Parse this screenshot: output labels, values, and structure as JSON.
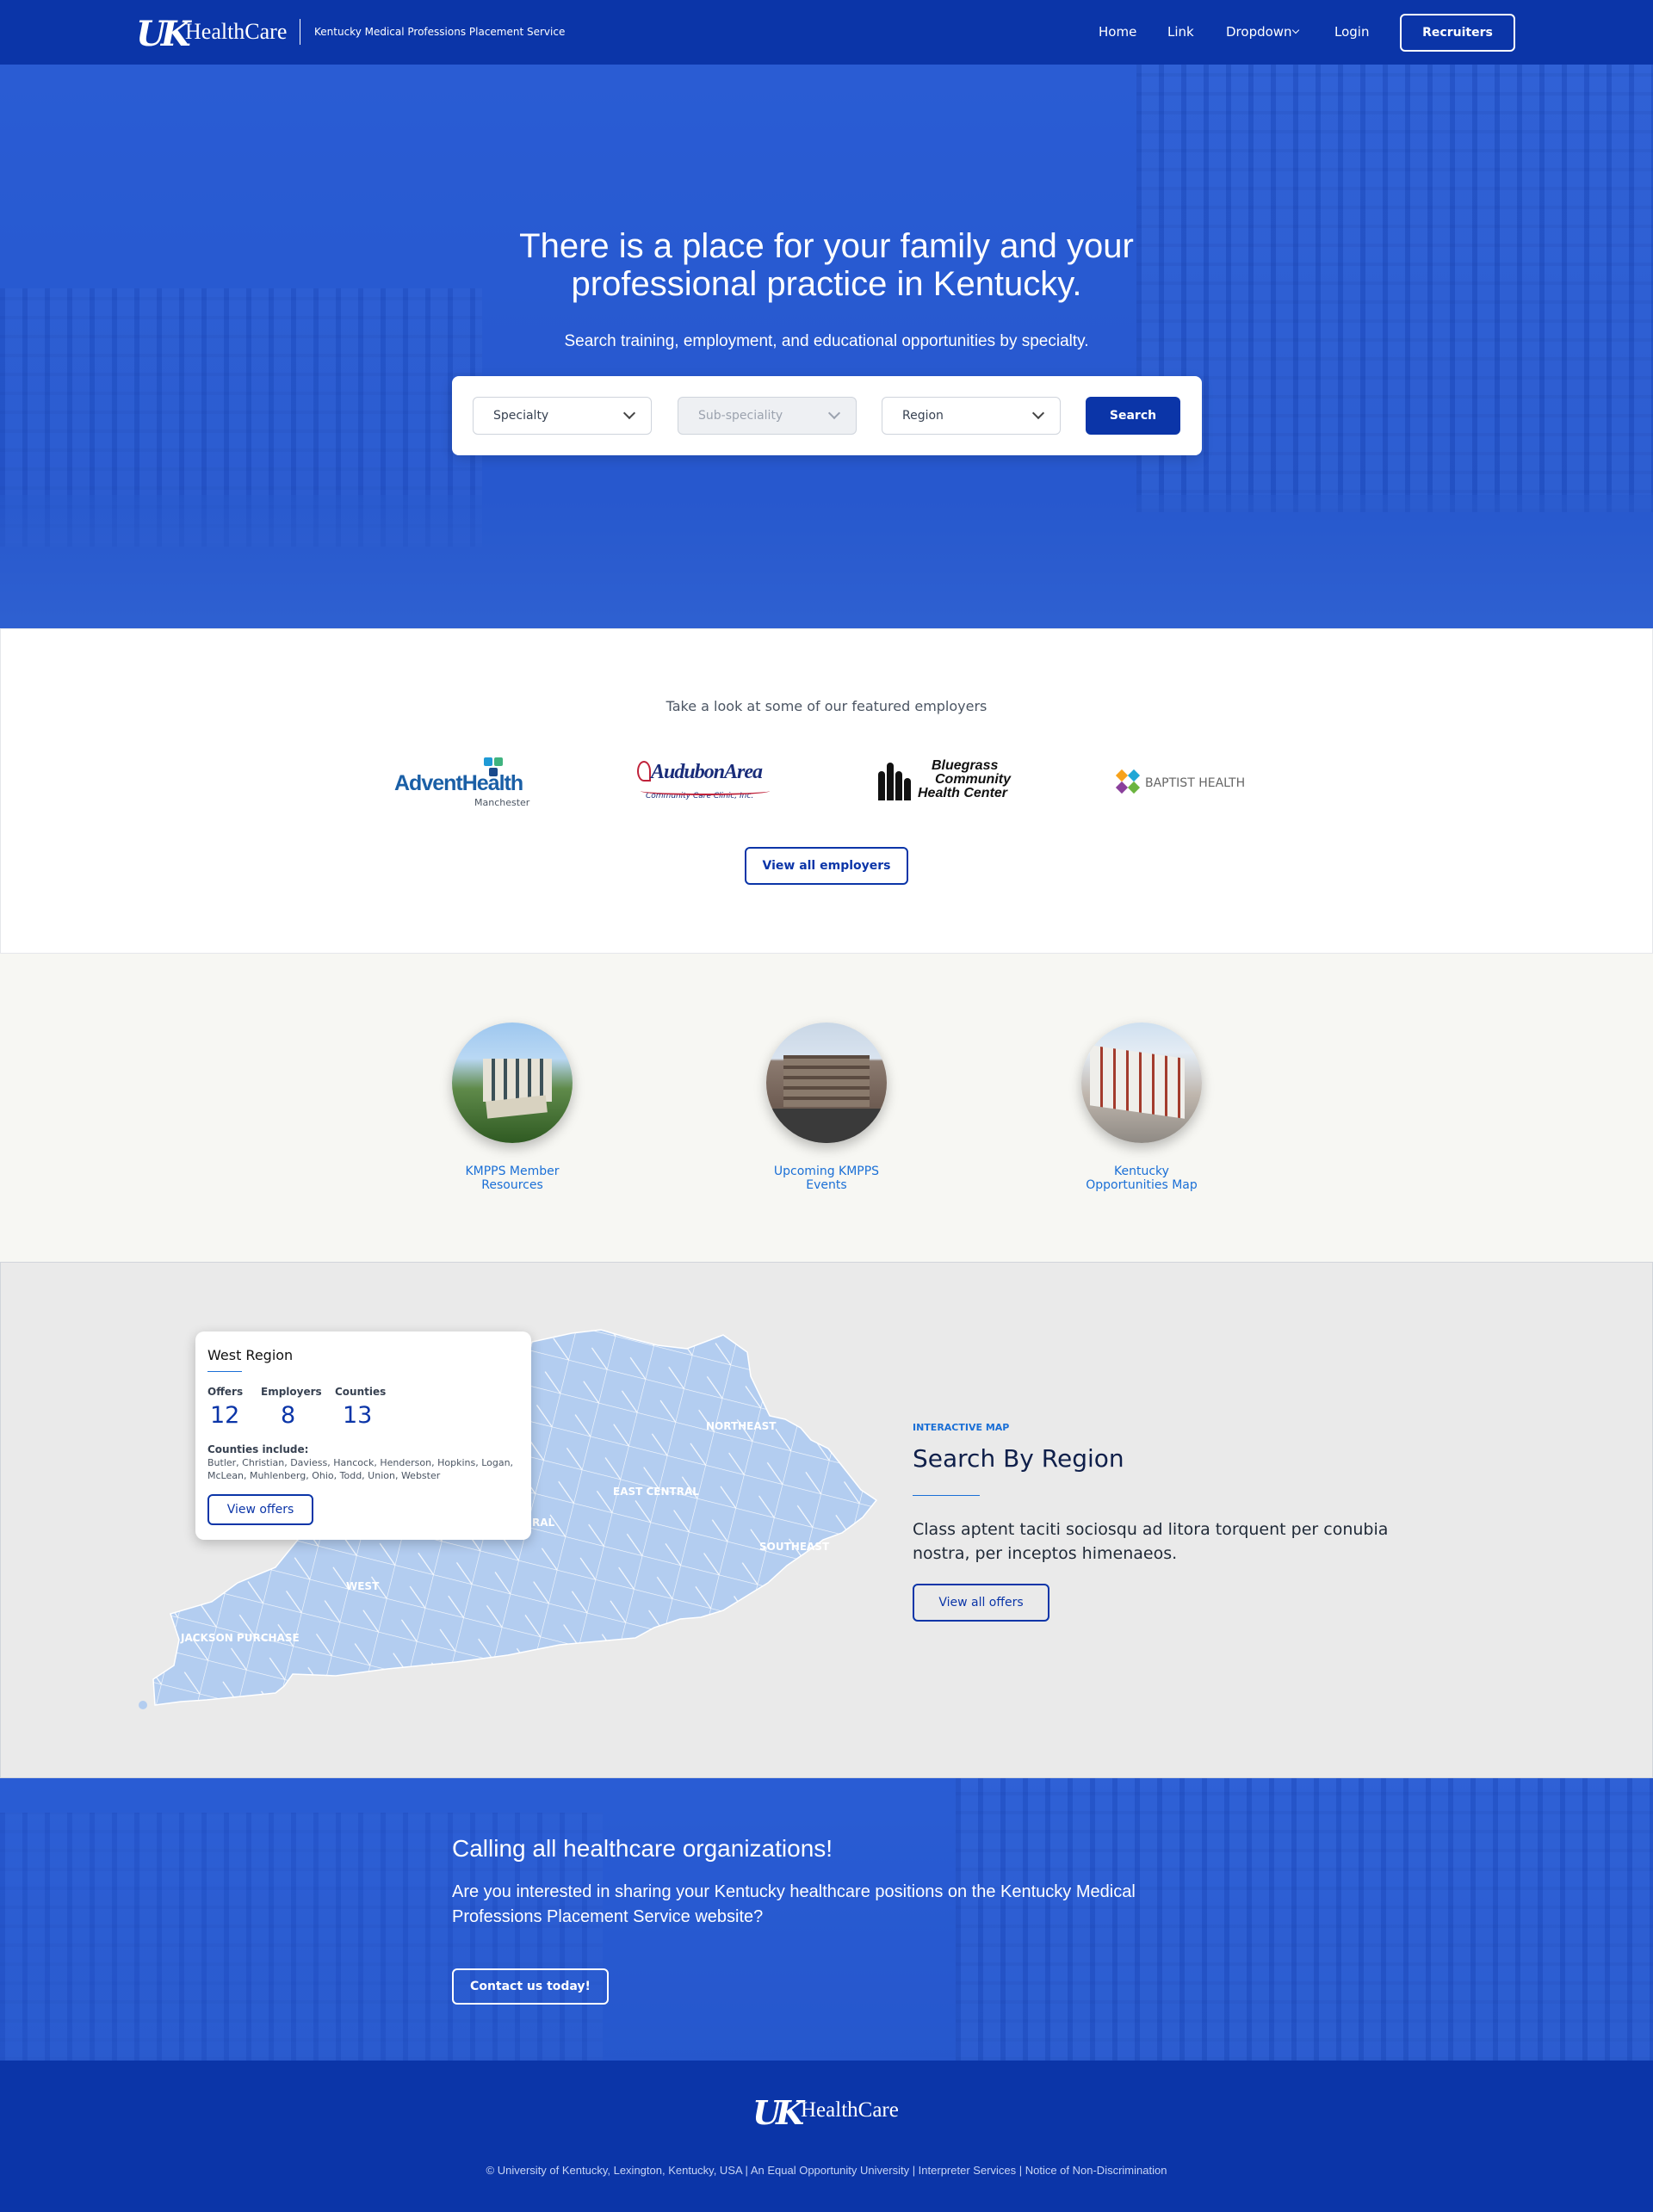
{
  "header": {
    "logo_mark": "UK",
    "logo_text": "HealthCare",
    "tagline": "Kentucky Medical Professions Placement Service",
    "nav": [
      "Home",
      "Link",
      "Dropdown",
      "Login"
    ],
    "cta": "Recruiters"
  },
  "hero": {
    "title_line1": "There is a place for your family and your",
    "title_line2": "professional practice in Kentucky.",
    "subtitle": "Search training, employment, and educational opportunities by specialty.",
    "specialty": "Specialty",
    "subspecialty": "Sub-speciality",
    "region": "Region",
    "search": "Search"
  },
  "employers": {
    "title": "Take a look at some of our featured employers",
    "logos": {
      "advent_main": "AdventHealth",
      "advent_sub": "Manchester",
      "audubon_main": "AudubonArea",
      "audubon_sub": "Community Care Clinic, Inc.",
      "bluegrass_1": "Bluegrass",
      "bluegrass_2": "Community",
      "bluegrass_3": "Health Center",
      "baptist": "BAPTIST HEALTH"
    },
    "view_all": "View all employers"
  },
  "resources": [
    {
      "line1": "KMPPS Member",
      "line2": "Resources"
    },
    {
      "line1": "Upcoming KMPPS",
      "line2": "Events"
    },
    {
      "line1": "Kentucky",
      "line2": "Opportunities Map"
    }
  ],
  "map": {
    "card": {
      "title": "West Region",
      "offers_label": "Offers",
      "offers": "12",
      "employers_label": "Employers",
      "employers": "8",
      "counties_label": "Counties",
      "counties": "13",
      "counties_include_label": "Counties include:",
      "counties_list_1": "Butler, Christian, Daviess, Hancock, Henderson, Hopkins, Logan,",
      "counties_list_2": "McLean, Muhlenberg, Ohio, Todd, Union, Webster",
      "button": "View offers"
    },
    "regions": {
      "northeast": "NORTHEAST",
      "east_central": "EAST CENTRAL",
      "southeast": "SOUTHEAST",
      "west": "WEST",
      "jackson": "JACKSON PURCHASE",
      "central_partial": "RAL"
    },
    "kicker": "INTERACTIVE MAP",
    "heading": "Search By Region",
    "body_1": "Class aptent taciti sociosqu ad litora torquent per conubia",
    "body_2": "nostra, per inceptos himenaeos.",
    "button": "View all offers"
  },
  "cta": {
    "heading": "Calling all healthcare organizations!",
    "body_1": "Are you interested in sharing your Kentucky healthcare positions on the Kentucky Medical",
    "body_2": "Professions Placement Service website?",
    "button": "Contact us today!"
  },
  "footer": {
    "logo_mark": "UK",
    "logo_text": "HealthCare",
    "legal": "© University of Kentucky, Lexington, Kentucky, USA | An Equal Opportunity University | Interpreter Services | Notice of Non-Discrimination"
  },
  "colors": {
    "brand_blue": "#0b35a8",
    "hero_blue": "#2b5dd0",
    "link_blue": "#1a6fd6",
    "map_fill": "#b3cdf0"
  }
}
